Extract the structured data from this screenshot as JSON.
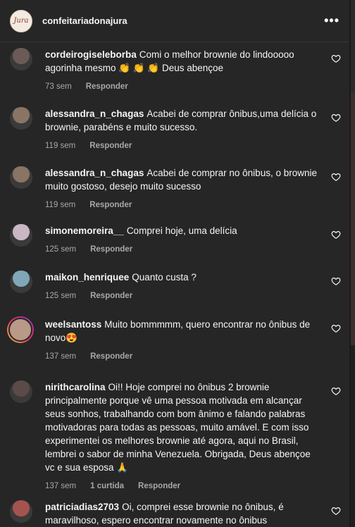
{
  "header": {
    "logo_text": "Jura",
    "account": "confeitariadonajura",
    "more": "•••"
  },
  "comments": [
    {
      "user": "cordeirogiseleborba",
      "text": "Comi o melhor brownie do lindooooo agorinha mesmo 👏 👏 👏  Deus abençoe",
      "time": "73 sem",
      "likes": "",
      "reply": "Responder",
      "avatar_color": "#6b5a55",
      "story": false
    },
    {
      "user": "alessandra_n_chagas",
      "text": "Acabei de comprar ônibus,uma delícia o brownie, parabéns e muito sucesso.",
      "time": "119 sem",
      "likes": "",
      "reply": "Responder",
      "avatar_color": "#8a7463",
      "story": false
    },
    {
      "user": "alessandra_n_chagas",
      "text": "Acabei de comprar no ônibus, o brownie muito gostoso, desejo muito sucesso",
      "time": "119 sem",
      "likes": "",
      "reply": "Responder",
      "avatar_color": "#8a7463",
      "story": false
    },
    {
      "user": "simonemoreira__",
      "text": "Comprei hoje, uma delícia",
      "time": "125 sem",
      "likes": "",
      "reply": "Responder",
      "avatar_color": "#c9b7c4",
      "story": false
    },
    {
      "user": "maikon_henriquee",
      "text": "Quanto custa ?",
      "time": "125 sem",
      "likes": "",
      "reply": "Responder",
      "avatar_color": "#7fa7b8",
      "story": false
    },
    {
      "user": "weelsantoss",
      "text": "Muito bommmmm, quero encontrar no ônibus de novo😍",
      "time": "137 sem",
      "likes": "",
      "reply": "Responder",
      "avatar_color": "#b89a86",
      "story": true
    },
    {
      "user": "nirithcarolina",
      "text": "Oi!! Hoje comprei no ônibus 2 brownie principalmente porque vê uma pessoa motivada em alcançar seus sonhos, trabalhando com bom ânimo e falando palabras motivadoras para todas as pessoas, muito amável. E com isso experimentei os melhores brownie até agora, aqui no Brasil, lembrei o sabor de minha Venezuela. Obrigada, Deus abençoe vc e sua esposa 🙏",
      "time": "137 sem",
      "likes": "1 curtida",
      "reply": "Responder",
      "avatar_color": "#5a4a48",
      "story": false
    },
    {
      "user": "patriciadias2703",
      "text": "Oi, comprei esse brownie no ônibus, é maravilhoso, espero encontrar novamente no ônibus",
      "time": "",
      "likes": "",
      "reply": "",
      "avatar_color": "#a5534f",
      "story": false
    }
  ]
}
